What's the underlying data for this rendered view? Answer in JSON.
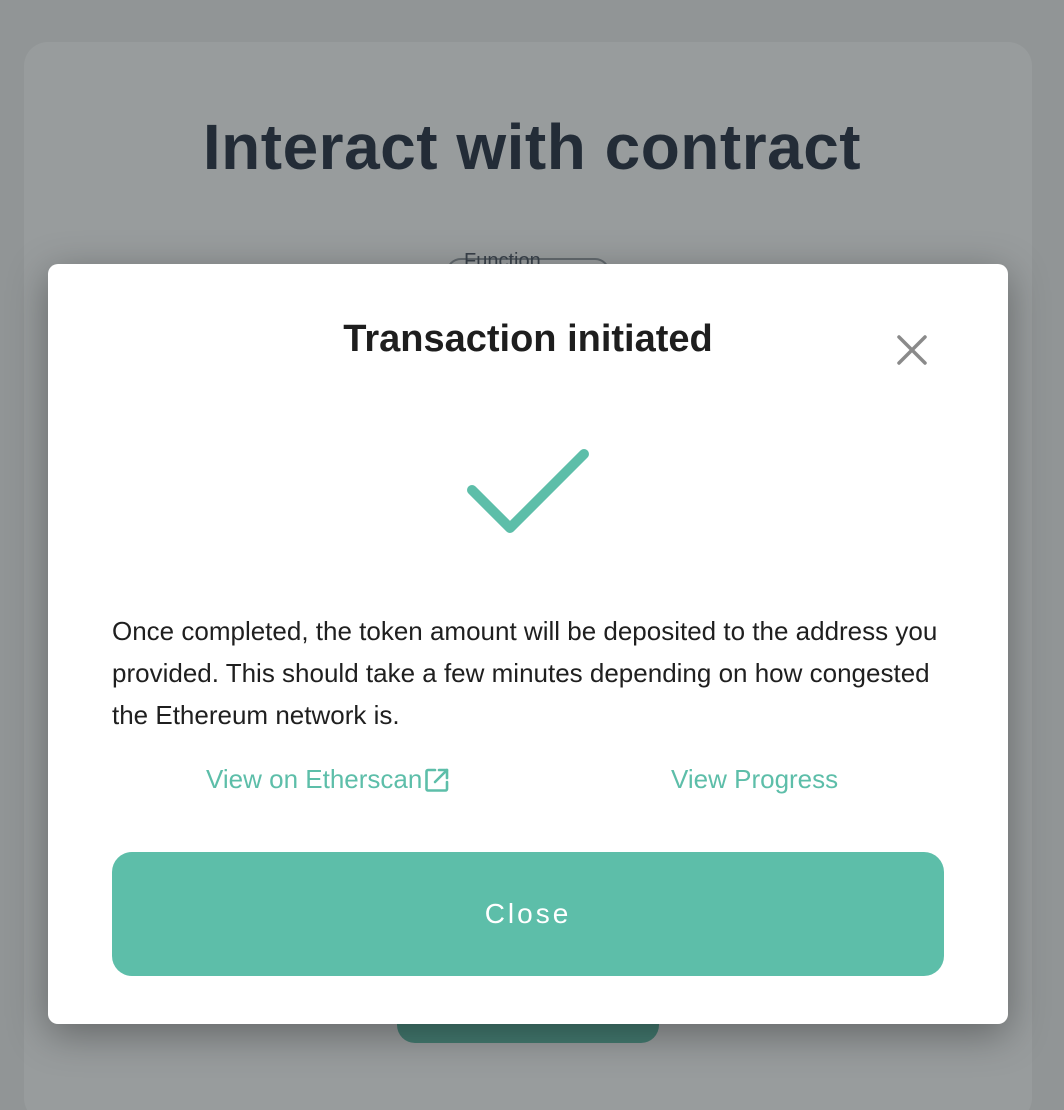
{
  "background": {
    "title": "Interact with contract",
    "function_label": "Function"
  },
  "modal": {
    "title": "Transaction initiated",
    "message": "Once completed, the token amount will be deposited to the address you provided. This should take a few minutes depending on how congested the Ethereum network is.",
    "etherscan_link": "View on Etherscan",
    "progress_link": "View Progress",
    "close_button": "Close"
  },
  "icons": {
    "close": "close-icon",
    "success": "checkmark-icon",
    "external": "external-link-icon"
  },
  "colors": {
    "accent": "#5dbea9",
    "title": "#1f2a3c",
    "text": "#1f1f1f"
  }
}
